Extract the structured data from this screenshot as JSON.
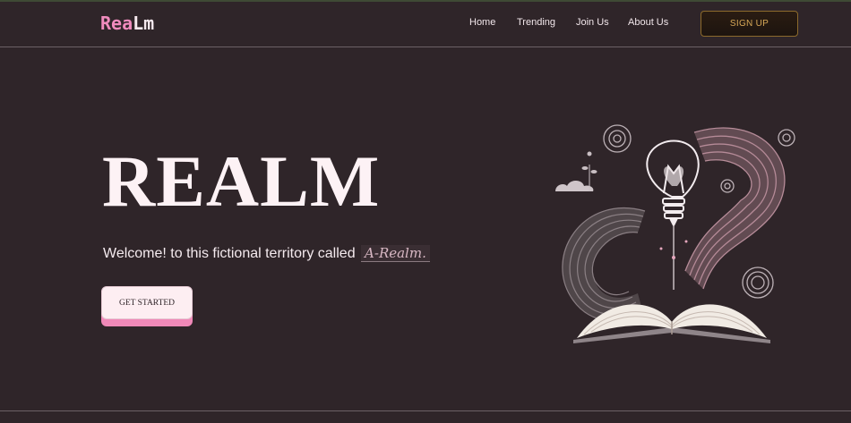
{
  "brand": {
    "logo_part1": "Rea",
    "logo_part2": "Lm"
  },
  "nav": {
    "links": [
      "Home",
      "Trending",
      "Join Us",
      "About Us"
    ],
    "signup_label": "SIGN UP"
  },
  "hero": {
    "title": "REALM",
    "welcome_text": "Welcome! to this fictional territory called",
    "realm_name": "A-Realm.",
    "cta_label": "GET STARTED"
  },
  "illustration": {
    "icon": "lightbulb-book-icon"
  },
  "colors": {
    "background": "#2f2529",
    "accent_pink": "#f08bbd",
    "signup_gold": "#d8a857"
  }
}
